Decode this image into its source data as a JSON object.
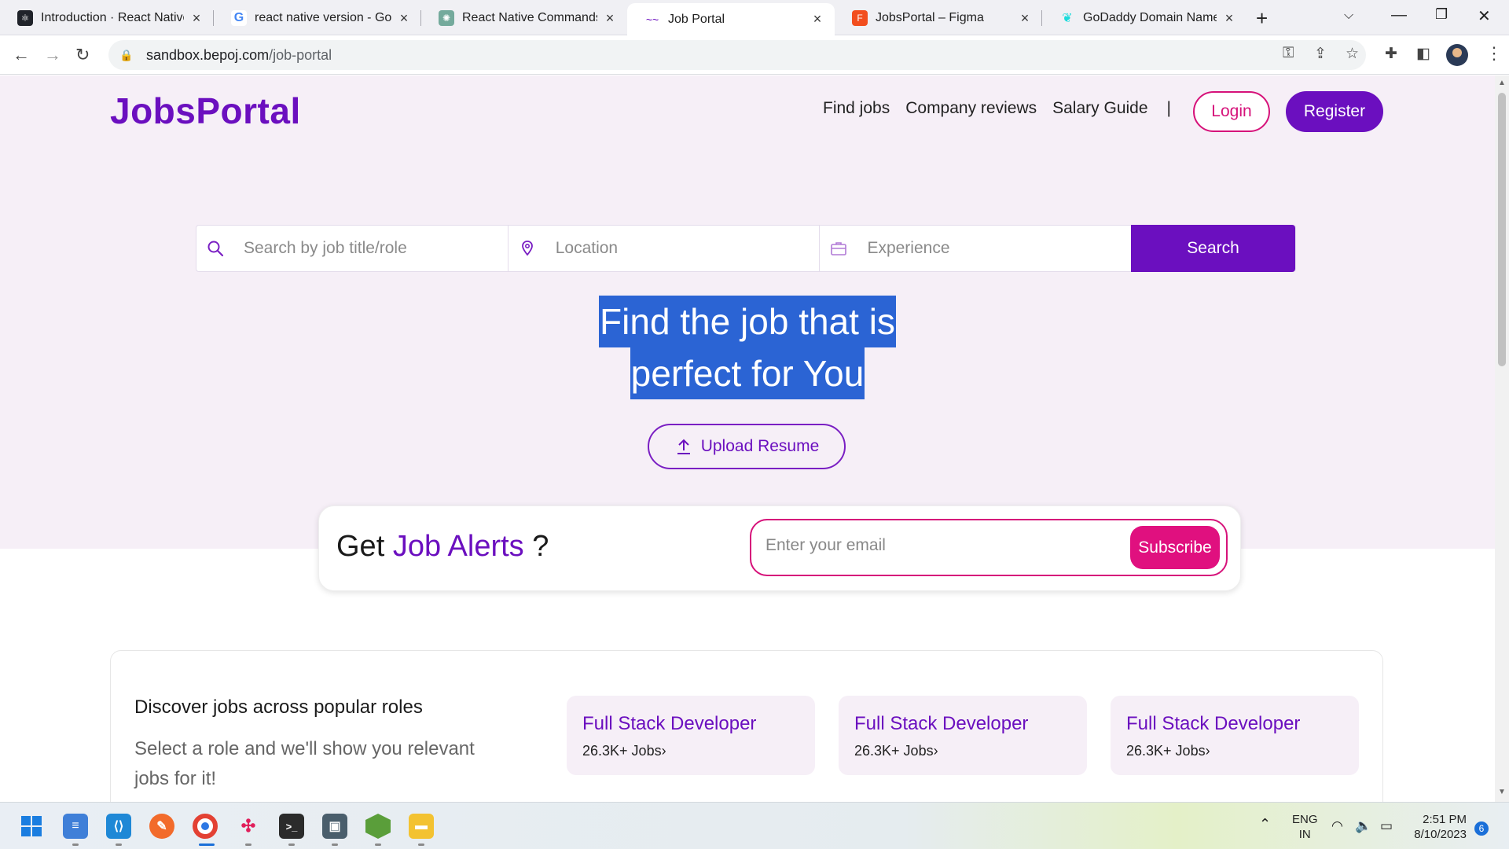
{
  "browser": {
    "tabs": [
      {
        "title": "Introduction · React Native",
        "favicon": "react-icon",
        "color": "#20232a"
      },
      {
        "title": "react native version - Google",
        "favicon": "google-icon",
        "color": "#4285f4"
      },
      {
        "title": "React Native Commands",
        "favicon": "chatgpt-icon",
        "color": "#74aa9c"
      },
      {
        "title": "Job Portal",
        "favicon": "job-portal-icon",
        "color": "#6b0fbf"
      },
      {
        "title": "JobsPortal – Figma",
        "favicon": "figma-icon",
        "color": "#f24e1e"
      },
      {
        "title": "GoDaddy Domain Name Se",
        "favicon": "godaddy-icon",
        "color": "#1bdbdb"
      }
    ],
    "url_host": "sandbox.bepoj.com",
    "url_path": "/job-portal"
  },
  "header": {
    "logo": "JobsPortal",
    "nav": [
      "Find jobs",
      "Company reviews",
      "Salary Guide"
    ],
    "separator": "|",
    "login_label": "Login",
    "register_label": "Register"
  },
  "search": {
    "job_placeholder": "Search by job title/role",
    "location_placeholder": "Location",
    "experience_placeholder": "Experience",
    "button_label": "Search"
  },
  "hero": {
    "line1": "Find the job that is",
    "line2": "perfect for You",
    "upload_label": "Upload Resume"
  },
  "alerts": {
    "prefix": "Get ",
    "accent": "Job Alerts",
    "suffix": " ?",
    "email_placeholder": "Enter your email",
    "subscribe_label": "Subscribe"
  },
  "roles": {
    "title": "Discover jobs across popular roles",
    "subtitle": "Select a role and we'll show you relevant jobs for it!",
    "items": [
      {
        "name": "Full Stack Developer",
        "count": "26.3K+ Jobs›"
      },
      {
        "name": "Full Stack Developer",
        "count": "26.3K+ Jobs›"
      },
      {
        "name": "Full Stack Developer",
        "count": "26.3K+ Jobs›"
      }
    ]
  },
  "taskbar": {
    "lang_top": "ENG",
    "lang_bottom": "IN",
    "time": "2:51 PM",
    "date": "8/10/2023",
    "notifications": "6"
  },
  "colors": {
    "brand": "#6b0fbf",
    "accent": "#e0107f",
    "hero_bg": "#f6eff7",
    "selection": "#2b64d4"
  }
}
